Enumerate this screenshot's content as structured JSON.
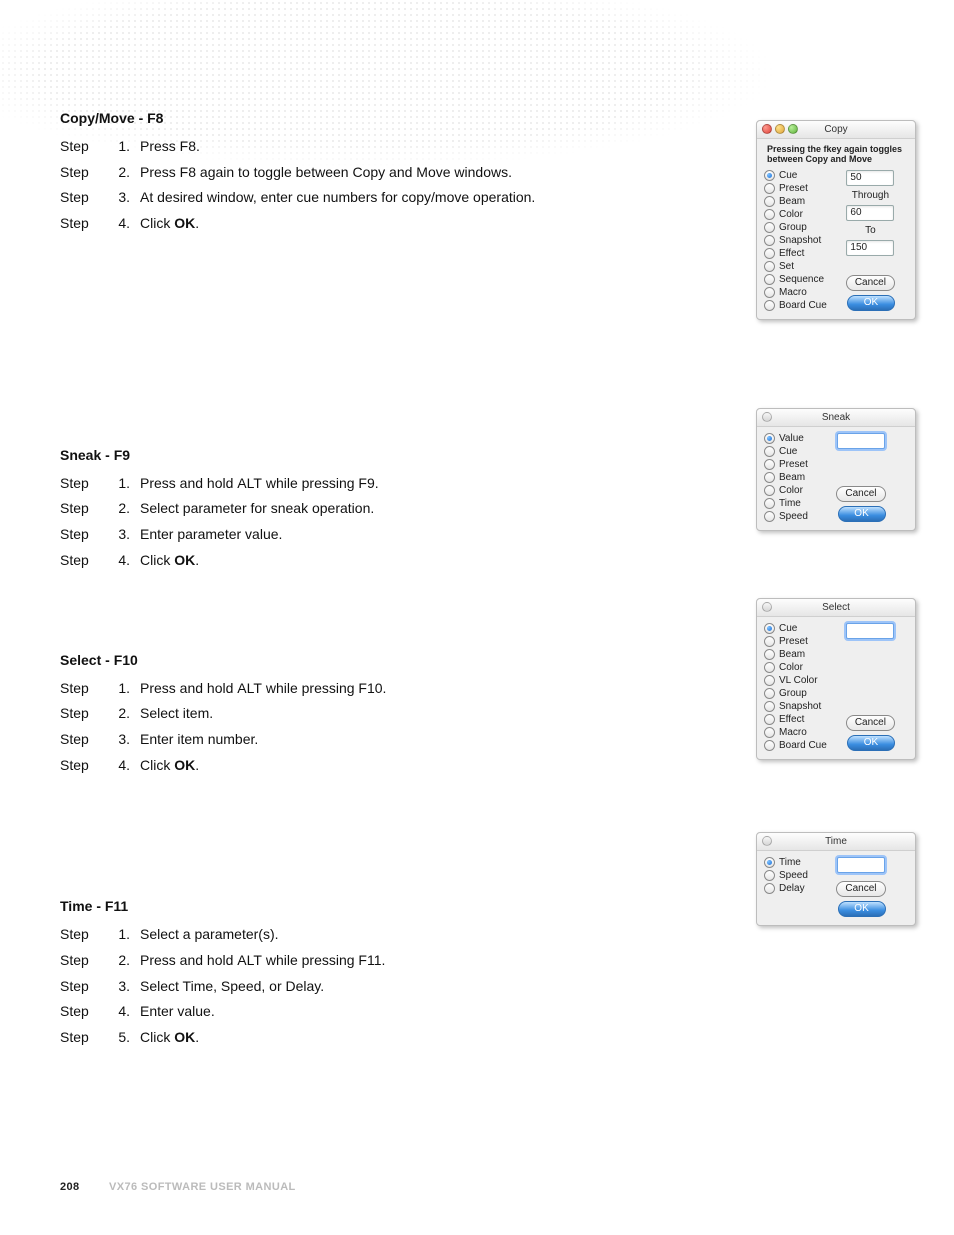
{
  "footer": {
    "page": "208",
    "manual": "VX76 SOFTWARE USER MANUAL"
  },
  "sections": [
    {
      "title": "Copy/Move - F8",
      "steps": [
        {
          "label": "Step",
          "num": "1.",
          "html": "Press F8."
        },
        {
          "label": "Step",
          "num": "2.",
          "html": "Press F8 again to toggle between Copy and Move windows."
        },
        {
          "label": "Step",
          "num": "3.",
          "html": "At desired window, enter cue numbers for copy/move operation."
        },
        {
          "label": "Step",
          "num": "4.",
          "html": "Click <span class='bold'>OK</span>."
        }
      ]
    },
    {
      "title": "Sneak - F9",
      "steps": [
        {
          "label": "Step",
          "num": "1.",
          "html": "Press and hold <span class='smallcaps'>ALT</span> while pressing F9."
        },
        {
          "label": "Step",
          "num": "2.",
          "html": "Select parameter for sneak operation."
        },
        {
          "label": "Step",
          "num": "3.",
          "html": "Enter parameter value."
        },
        {
          "label": "Step",
          "num": "4.",
          "html": "Click <span class='bold'>OK</span>."
        }
      ]
    },
    {
      "title": "Select - F10",
      "steps": [
        {
          "label": "Step",
          "num": "1.",
          "html": "Press and hold <span class='smallcaps'>ALT</span> while pressing F10."
        },
        {
          "label": "Step",
          "num": "2.",
          "html": "Select item."
        },
        {
          "label": "Step",
          "num": "3.",
          "html": "Enter item number."
        },
        {
          "label": "Step",
          "num": "4.",
          "html": "Click <span class='bold'>OK</span>."
        }
      ]
    },
    {
      "title": "Time - F11",
      "steps": [
        {
          "label": "Step",
          "num": "1.",
          "html": "Select a parameter(s)."
        },
        {
          "label": "Step",
          "num": "2.",
          "html": "Press and hold <span class='smallcaps'>ALT</span> while pressing F11."
        },
        {
          "label": "Step",
          "num": "3.",
          "html": "Select Time, Speed, or Delay."
        },
        {
          "label": "Step",
          "num": "4.",
          "html": "Enter value."
        },
        {
          "label": "Step",
          "num": "5.",
          "html": "Click <span class='bold'>OK</span>."
        }
      ]
    }
  ],
  "dialogs": {
    "copy": {
      "title": "Copy",
      "note": "Pressing the fkey again toggles between Copy and Move",
      "radios": [
        "Cue",
        "Preset",
        "Beam",
        "Color",
        "Group",
        "Snapshot",
        "Effect",
        "Set",
        "Sequence",
        "Macro",
        "Board Cue"
      ],
      "selected": 0,
      "field1": "50",
      "label1": "Through",
      "field2": "60",
      "label2": "To",
      "field3": "150",
      "cancel": "Cancel",
      "ok": "OK"
    },
    "sneak": {
      "title": "Sneak",
      "radios": [
        "Value",
        "Cue",
        "Preset",
        "Beam",
        "Color",
        "Time",
        "Speed"
      ],
      "selected": 0,
      "field": "",
      "cancel": "Cancel",
      "ok": "OK"
    },
    "select": {
      "title": "Select",
      "radios": [
        "Cue",
        "Preset",
        "Beam",
        "Color",
        "VL Color",
        "Group",
        "Snapshot",
        "Effect",
        "Macro",
        "Board Cue"
      ],
      "selected": 0,
      "field": "",
      "cancel": "Cancel",
      "ok": "OK"
    },
    "time": {
      "title": "Time",
      "radios": [
        "Time",
        "Speed",
        "Delay"
      ],
      "selected": 0,
      "field": "",
      "cancel": "Cancel",
      "ok": "OK"
    }
  }
}
